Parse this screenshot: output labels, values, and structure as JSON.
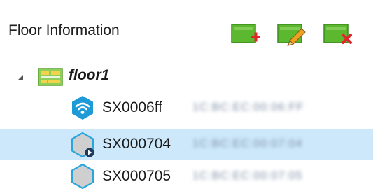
{
  "header": {
    "title": "Floor Information",
    "buttons": [
      {
        "name": "add-floor",
        "icon": "add-icon",
        "accent": "#e2262c"
      },
      {
        "name": "edit-floor",
        "icon": "pencil-icon",
        "accent": "#f0a020"
      },
      {
        "name": "delete-floor",
        "icon": "delete-x-icon",
        "accent": "#e2262c"
      }
    ]
  },
  "tree": {
    "floor": {
      "label": "floor1",
      "expanded": true,
      "icon": "floor-plan-icon"
    },
    "devices": [
      {
        "label": "SX0006ff",
        "id_text": "1C:BC:EC:00:06:FF",
        "icon": "wifi-hex-icon",
        "selected": false
      },
      {
        "label": "SX000704",
        "id_text": "1C:BC:EC:00:07:04",
        "icon": "hex-play-icon",
        "selected": true
      },
      {
        "label": "SX000705",
        "id_text": "1C:BC:EC:00:07:05",
        "icon": "hex-icon",
        "selected": false
      }
    ]
  },
  "colors": {
    "selection": "#cde8fb",
    "icon_green": "#5cb82e",
    "icon_blue": "#1e9bd7",
    "hex_outline": "#2aa6de",
    "hex_fill": "#cfcfcf"
  }
}
